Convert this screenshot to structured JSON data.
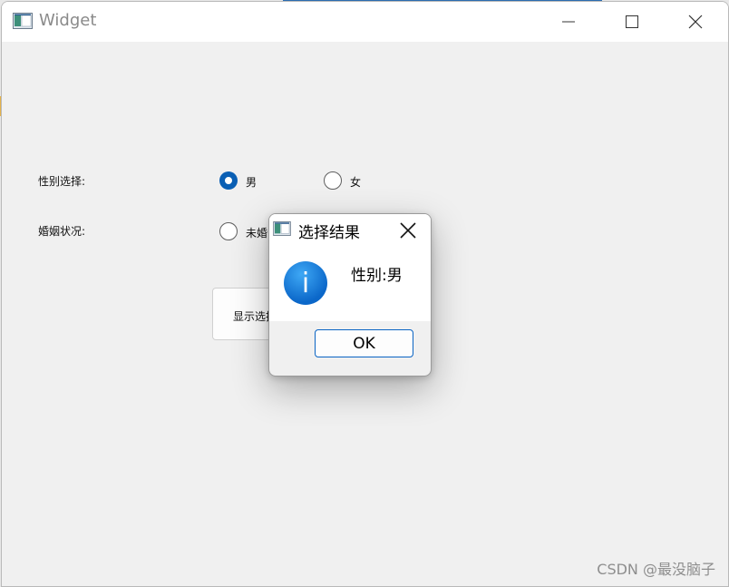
{
  "window": {
    "title": "Widget",
    "icon": "app-window-icon",
    "controls": {
      "minimize": "minimize-icon",
      "maximize": "maximize-icon",
      "close": "close-icon"
    }
  },
  "form": {
    "gender_label": "性别选择:",
    "gender_options": [
      {
        "label": "男",
        "checked": true
      },
      {
        "label": "女",
        "checked": false
      }
    ],
    "marital_label": "婚姻状况:",
    "marital_options": [
      {
        "label": "未婚",
        "checked": false
      }
    ],
    "show_button_label": "显示选择"
  },
  "dialog": {
    "title": "选择结果",
    "message": "性别:男",
    "icon": "info-icon",
    "ok_label": "OK"
  },
  "watermark": "CSDN @最没脑子",
  "colors": {
    "accent": "#0a5fb4",
    "info_icon": "#1478d4"
  }
}
